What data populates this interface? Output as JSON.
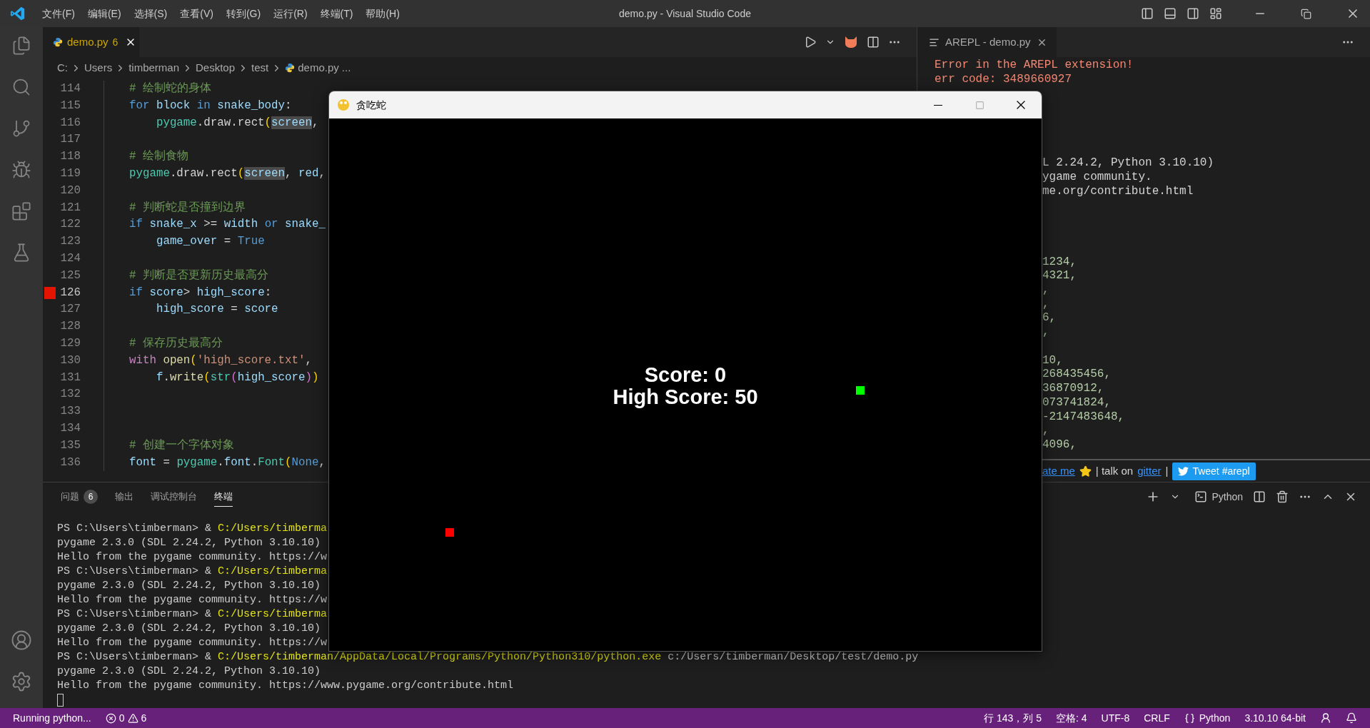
{
  "window": {
    "title": "demo.py - Visual Studio Code"
  },
  "menu": [
    "文件(F)",
    "编辑(E)",
    "选择(S)",
    "查看(V)",
    "转到(G)",
    "运行(R)",
    "终端(T)",
    "帮助(H)"
  ],
  "editor": {
    "tab": {
      "label": "demo.py",
      "problems": "6"
    },
    "breadcrumb": [
      "C:",
      "Users",
      "timberman",
      "Desktop",
      "test",
      "demo.py",
      "..."
    ],
    "lines": [
      {
        "number": "114",
        "marked": false,
        "tokens": [
          {
            "kind": "cmt",
            "text": "# 绘制蛇的身体"
          }
        ]
      },
      {
        "number": "115",
        "marked": false,
        "tokens": [
          {
            "kind": "kw",
            "text": "for "
          },
          {
            "kind": "var",
            "text": "block "
          },
          {
            "kind": "kw",
            "text": "in "
          },
          {
            "kind": "var",
            "text": "snake_body"
          },
          {
            "kind": "plain",
            "text": ":"
          }
        ]
      },
      {
        "number": "116",
        "marked": false,
        "tokens": [
          {
            "kind": "cls",
            "text": "    pygame"
          },
          {
            "kind": "plain",
            "text": ".draw.rect"
          },
          {
            "kind": "br1",
            "text": "("
          },
          {
            "kind": "hl",
            "text": "screen"
          },
          {
            "kind": "plain",
            "text": ","
          }
        ]
      },
      {
        "number": "117",
        "marked": false
      },
      {
        "number": "118",
        "marked": false,
        "tokens": [
          {
            "kind": "cmt",
            "text": "# 绘制食物"
          }
        ]
      },
      {
        "number": "119",
        "marked": false,
        "tokens": [
          {
            "kind": "cls",
            "text": "pygame"
          },
          {
            "kind": "plain",
            "text": ".draw.rect"
          },
          {
            "kind": "br1",
            "text": "("
          },
          {
            "kind": "hl",
            "text": "screen"
          },
          {
            "kind": "plain",
            "text": ", "
          },
          {
            "kind": "var",
            "text": "red"
          },
          {
            "kind": "plain",
            "text": ","
          }
        ]
      },
      {
        "number": "120",
        "marked": false
      },
      {
        "number": "121",
        "marked": false,
        "tokens": [
          {
            "kind": "cmt",
            "text": "# 判断蛇是否撞到边界"
          }
        ]
      },
      {
        "number": "122",
        "marked": false,
        "tokens": [
          {
            "kind": "kw",
            "text": "if "
          },
          {
            "kind": "var",
            "text": "snake_x"
          },
          {
            "kind": "plain",
            "text": " >= "
          },
          {
            "kind": "var",
            "text": "width "
          },
          {
            "kind": "kw",
            "text": "or "
          },
          {
            "kind": "var",
            "text": "snake_"
          }
        ]
      },
      {
        "number": "123",
        "marked": false,
        "tokens": [
          {
            "kind": "var",
            "text": "    game_over"
          },
          {
            "kind": "plain",
            "text": " = "
          },
          {
            "kind": "const",
            "text": "True"
          }
        ]
      },
      {
        "number": "124",
        "marked": false
      },
      {
        "number": "125",
        "marked": false,
        "tokens": [
          {
            "kind": "cmt",
            "text": "# 判断是否更新历史最高分"
          }
        ]
      },
      {
        "number": "126",
        "marked": true,
        "tokens": [
          {
            "kind": "kw",
            "text": "if "
          },
          {
            "kind": "var",
            "text": "score"
          },
          {
            "kind": "plain",
            "text": "> "
          },
          {
            "kind": "var",
            "text": "high_score"
          },
          {
            "kind": "plain",
            "text": ":"
          }
        ]
      },
      {
        "number": "127",
        "marked": false,
        "tokens": [
          {
            "kind": "var",
            "text": "    high_score"
          },
          {
            "kind": "plain",
            "text": " = "
          },
          {
            "kind": "var",
            "text": "score"
          }
        ]
      },
      {
        "number": "128",
        "marked": false
      },
      {
        "number": "129",
        "marked": false,
        "tokens": [
          {
            "kind": "cmt",
            "text": "# 保存历史最高分"
          }
        ]
      },
      {
        "number": "130",
        "marked": false,
        "tokens": [
          {
            "kind": "ctl",
            "text": "with "
          },
          {
            "kind": "fn",
            "text": "open"
          },
          {
            "kind": "br1",
            "text": "("
          },
          {
            "kind": "str",
            "text": "'high_score.txt'"
          },
          {
            "kind": "plain",
            "text": ", "
          }
        ]
      },
      {
        "number": "131",
        "marked": false,
        "tokens": [
          {
            "kind": "var",
            "text": "    f"
          },
          {
            "kind": "plain",
            "text": "."
          },
          {
            "kind": "fn",
            "text": "write"
          },
          {
            "kind": "br1",
            "text": "("
          },
          {
            "kind": "cls",
            "text": "str"
          },
          {
            "kind": "br2",
            "text": "("
          },
          {
            "kind": "var",
            "text": "high_score"
          },
          {
            "kind": "br2",
            "text": ")"
          },
          {
            "kind": "br1",
            "text": ")"
          }
        ]
      },
      {
        "number": "132",
        "marked": false
      },
      {
        "number": "133",
        "marked": false
      },
      {
        "number": "134",
        "marked": false
      },
      {
        "number": "135",
        "marked": false,
        "tokens": [
          {
            "kind": "cmt",
            "text": "# 创建一个字体对象"
          }
        ]
      },
      {
        "number": "136",
        "marked": false,
        "tokens": [
          {
            "kind": "var",
            "text": "font"
          },
          {
            "kind": "plain",
            "text": " = "
          },
          {
            "kind": "cls",
            "text": "pygame"
          },
          {
            "kind": "plain",
            "text": "."
          },
          {
            "kind": "var",
            "text": "font"
          },
          {
            "kind": "plain",
            "text": "."
          },
          {
            "kind": "cls",
            "text": "Font"
          },
          {
            "kind": "br1",
            "text": "("
          },
          {
            "kind": "const",
            "text": "None"
          },
          {
            "kind": "plain",
            "text": ","
          }
        ]
      }
    ]
  },
  "arepl": {
    "tab": {
      "label": "AREPL - demo.py"
    },
    "error_lines": [
      "Error in the AREPL extension!",
      "err code: 3489660927"
    ],
    "output_blocks": [
      {
        "kind": "text",
        "lines": [
          "L 2.24.2, Python 3.10.10)",
          "ygame community.",
          "me.org/contribute.html"
        ]
      },
      {
        "kind": "numbers",
        "lines": [
          "1234,",
          "4321,",
          ",",
          ",",
          "6,",
          ","
        ]
      },
      {
        "kind": "numbers",
        "lines": [
          "10,",
          "268435456,",
          "36870912,",
          "073741824,",
          "-2147483648,",
          ",",
          "4096,"
        ]
      }
    ],
    "footer": [
      {
        "kind": "link",
        "text": "ate me"
      },
      {
        "kind": "star"
      },
      {
        "kind": "text",
        "text": "| talk on"
      },
      {
        "kind": "link",
        "text": "gitter"
      },
      {
        "kind": "text",
        "text": "|"
      },
      {
        "kind": "button",
        "text": "Tweet #arepl"
      }
    ]
  },
  "panel": {
    "tabs": [
      {
        "label": "问题",
        "badge": "6",
        "selected": false
      },
      {
        "label": "输出",
        "selected": false
      },
      {
        "label": "调试控制台",
        "selected": false
      },
      {
        "label": "终端",
        "selected": true
      }
    ],
    "profile": "Python",
    "terminal_lines": [
      [
        {
          "kind": "plain",
          "text": "PS C:\\Users\\timberman> & "
        },
        {
          "kind": "path",
          "text": "C:/Users/timberma"
        }
      ],
      [
        {
          "kind": "plain",
          "text": "pygame 2.3.0 (SDL 2.24.2, Python 3.10.10)"
        }
      ],
      [
        {
          "kind": "plain",
          "text": "Hello from the pygame community. https://w"
        }
      ],
      [
        {
          "kind": "plain",
          "text": "PS C:\\Users\\timberman> & "
        },
        {
          "kind": "path",
          "text": "C:/Users/timberma"
        }
      ],
      [
        {
          "kind": "plain",
          "text": "pygame 2.3.0 (SDL 2.24.2, Python 3.10.10)"
        }
      ],
      [
        {
          "kind": "plain",
          "text": "Hello from the pygame community. https://w"
        }
      ],
      [
        {
          "kind": "plain",
          "text": "PS C:\\Users\\timberman> & "
        },
        {
          "kind": "path",
          "text": "C:/Users/timberma"
        }
      ],
      [
        {
          "kind": "plain",
          "text": "pygame 2.3.0 (SDL 2.24.2, Python 3.10.10)"
        }
      ],
      [
        {
          "kind": "plain",
          "text": "Hello from the pygame community. https://w"
        }
      ],
      [
        {
          "kind": "plain",
          "text": "PS C:\\Users\\timberman> & "
        },
        {
          "kind": "path",
          "text": "C:/Users/timberman/AppData/Local/Programs/Python/Python310/python.exe"
        },
        {
          "kind": "arg",
          "text": " c:/Users/timberman/Desktop/test/demo.py"
        }
      ],
      [
        {
          "kind": "plain",
          "text": "pygame 2.3.0 (SDL 2.24.2, Python 3.10.10)"
        }
      ],
      [
        {
          "kind": "plain",
          "text": "Hello from the pygame community. https://www.pygame.org/contribute.html"
        }
      ]
    ]
  },
  "status_bar": {
    "task": "Running python...",
    "errors": "0",
    "warnings": "6",
    "right": [
      "行 143，列 5",
      "空格: 4",
      "UTF-8",
      "CRLF"
    ],
    "language": "Python",
    "interpreter": "3.10.10 64-bit"
  },
  "game_window": {
    "title": "贪吃蛇",
    "lines": [
      "Score: 0",
      "High Score: 50"
    ]
  }
}
